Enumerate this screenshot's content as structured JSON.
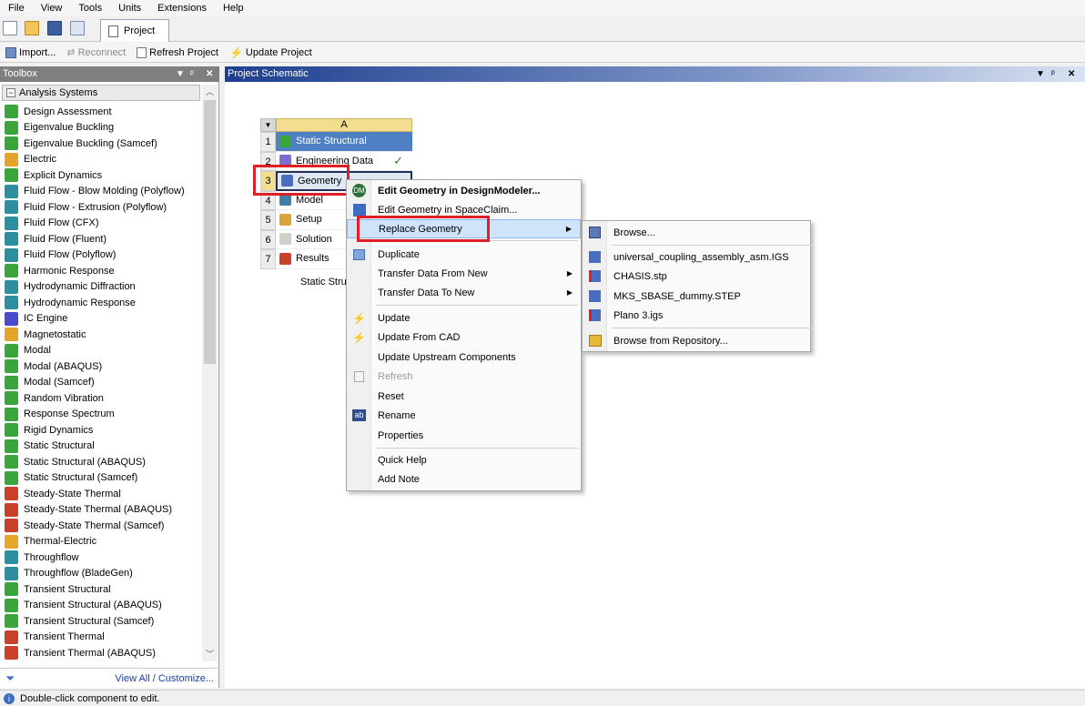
{
  "menubar": [
    "File",
    "View",
    "Tools",
    "Units",
    "Extensions",
    "Help"
  ],
  "tabs": {
    "project": "Project"
  },
  "toolbar": {
    "import": "Import...",
    "reconnect": "Reconnect",
    "refresh": "Refresh Project",
    "update": "Update Project"
  },
  "toolbox": {
    "title": "Toolbox",
    "section": "Analysis Systems",
    "items": [
      {
        "label": "Design Assessment",
        "color": "#3aa53a"
      },
      {
        "label": "Eigenvalue Buckling",
        "color": "#3aa53a"
      },
      {
        "label": "Eigenvalue Buckling (Samcef)",
        "color": "#3aa53a"
      },
      {
        "label": "Electric",
        "color": "#e4a52a"
      },
      {
        "label": "Explicit Dynamics",
        "color": "#3aa53a"
      },
      {
        "label": "Fluid Flow - Blow Molding (Polyflow)",
        "color": "#2b8fa0"
      },
      {
        "label": "Fluid Flow - Extrusion (Polyflow)",
        "color": "#2b8fa0"
      },
      {
        "label": "Fluid Flow (CFX)",
        "color": "#2b8fa0"
      },
      {
        "label": "Fluid Flow (Fluent)",
        "color": "#2b8fa0"
      },
      {
        "label": "Fluid Flow (Polyflow)",
        "color": "#2b8fa0"
      },
      {
        "label": "Harmonic Response",
        "color": "#3aa53a"
      },
      {
        "label": "Hydrodynamic Diffraction",
        "color": "#2b8fa0"
      },
      {
        "label": "Hydrodynamic Response",
        "color": "#2b8fa0"
      },
      {
        "label": "IC Engine",
        "color": "#4b4bcf"
      },
      {
        "label": "Magnetostatic",
        "color": "#e4a52a"
      },
      {
        "label": "Modal",
        "color": "#3aa53a"
      },
      {
        "label": "Modal (ABAQUS)",
        "color": "#3aa53a"
      },
      {
        "label": "Modal (Samcef)",
        "color": "#3aa53a"
      },
      {
        "label": "Random Vibration",
        "color": "#3aa53a"
      },
      {
        "label": "Response Spectrum",
        "color": "#3aa53a"
      },
      {
        "label": "Rigid Dynamics",
        "color": "#3aa53a"
      },
      {
        "label": "Static Structural",
        "color": "#3aa53a"
      },
      {
        "label": "Static Structural (ABAQUS)",
        "color": "#3aa53a"
      },
      {
        "label": "Static Structural (Samcef)",
        "color": "#3aa53a"
      },
      {
        "label": "Steady-State Thermal",
        "color": "#c9412b"
      },
      {
        "label": "Steady-State Thermal (ABAQUS)",
        "color": "#c9412b"
      },
      {
        "label": "Steady-State Thermal (Samcef)",
        "color": "#c9412b"
      },
      {
        "label": "Thermal-Electric",
        "color": "#e4a52a"
      },
      {
        "label": "Throughflow",
        "color": "#2b8fa0"
      },
      {
        "label": "Throughflow (BladeGen)",
        "color": "#2b8fa0"
      },
      {
        "label": "Transient Structural",
        "color": "#3aa53a"
      },
      {
        "label": "Transient Structural (ABAQUS)",
        "color": "#3aa53a"
      },
      {
        "label": "Transient Structural (Samcef)",
        "color": "#3aa53a"
      },
      {
        "label": "Transient Thermal",
        "color": "#c9412b"
      },
      {
        "label": "Transient Thermal (ABAQUS)",
        "color": "#c9412b"
      }
    ],
    "footer_link": "View All / Customize..."
  },
  "schematic": {
    "title": "Project Schematic",
    "system": {
      "column": "A",
      "rows": [
        {
          "num": "1",
          "label": "Static Structural"
        },
        {
          "num": "2",
          "label": "Engineering Data"
        },
        {
          "num": "3",
          "label": "Geometry"
        },
        {
          "num": "4",
          "label": "Model"
        },
        {
          "num": "5",
          "label": "Setup"
        },
        {
          "num": "6",
          "label": "Solution"
        },
        {
          "num": "7",
          "label": "Results"
        }
      ],
      "caption": "Static Stru"
    }
  },
  "context_menu": {
    "items": [
      {
        "label": "Edit Geometry in DesignModeler..."
      },
      {
        "label": "Edit Geometry in SpaceClaim..."
      },
      {
        "label": "Replace Geometry"
      },
      {
        "label": "Duplicate"
      },
      {
        "label": "Transfer Data From New"
      },
      {
        "label": "Transfer Data To New"
      },
      {
        "label": "Update"
      },
      {
        "label": "Update From CAD"
      },
      {
        "label": "Update Upstream Components"
      },
      {
        "label": "Refresh"
      },
      {
        "label": "Reset"
      },
      {
        "label": "Rename"
      },
      {
        "label": "Properties"
      },
      {
        "label": "Quick Help"
      },
      {
        "label": "Add Note"
      }
    ]
  },
  "submenu": {
    "items": [
      {
        "label": "Browse..."
      },
      {
        "label": "universal_coupling_assembly_asm.IGS"
      },
      {
        "label": "CHASIS.stp"
      },
      {
        "label": "MKS_SBASE_dummy.STEP"
      },
      {
        "label": "Plano 3.igs"
      },
      {
        "label": "Browse from Repository..."
      }
    ]
  },
  "status": {
    "text": "Double-click component to edit."
  },
  "colors": {
    "highlight_box": "#e01e25",
    "title_blue": "#4f80c3"
  }
}
